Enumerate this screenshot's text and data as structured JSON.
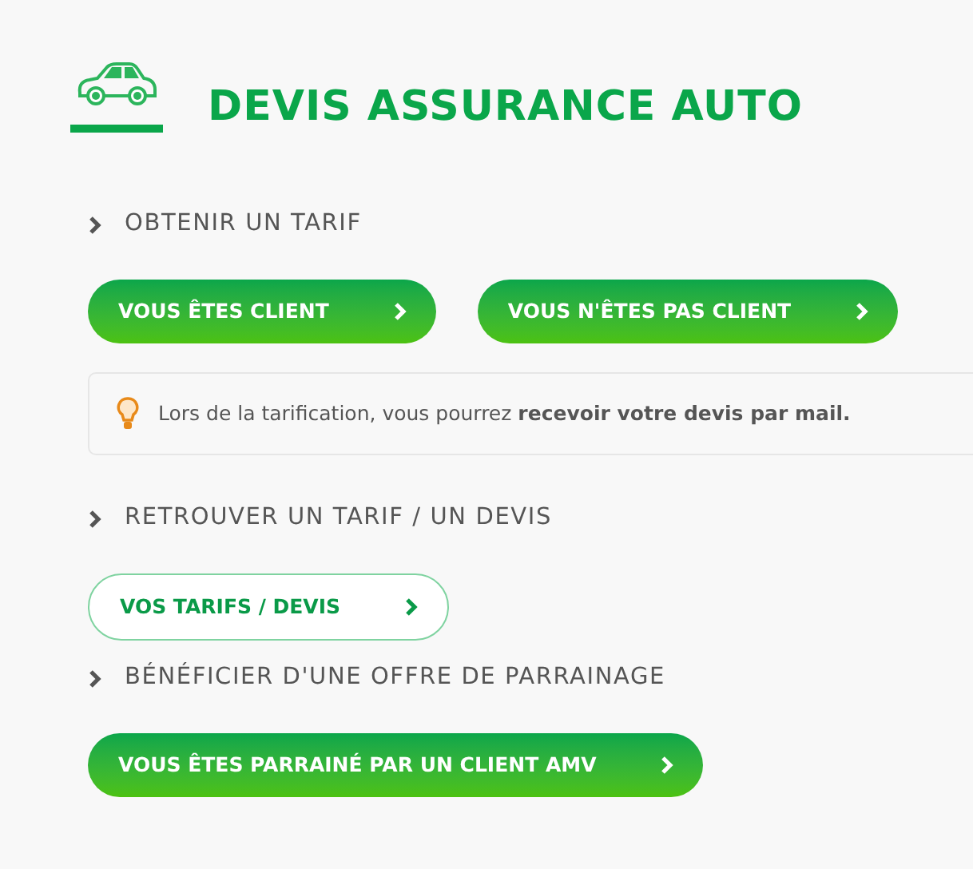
{
  "header": {
    "title": "DEVIS ASSURANCE AUTO"
  },
  "sections": [
    {
      "heading": "OBTENIR UN TARIF",
      "buttons": [
        {
          "label": "VOUS ÊTES CLIENT",
          "kind": "filled"
        },
        {
          "label": "VOUS N'ÊTES PAS CLIENT",
          "kind": "filled"
        }
      ],
      "notice": "Lors de la tarification, vous pourrez **recevoir votre devis par mail.**"
    },
    {
      "heading": "RETROUVER UN TARIF / UN DEVIS",
      "buttons": [
        {
          "label": "VOS TARIFS / DEVIS",
          "kind": "outline"
        }
      ]
    },
    {
      "heading": "BÉNÉFICIER D'UNE OFFRE DE PARRAINAGE",
      "buttons": [
        {
          "label": "VOUS ÊTES PARRAINÉ PAR UN CLIENT AMV",
          "kind": "filled"
        }
      ]
    }
  ]
}
